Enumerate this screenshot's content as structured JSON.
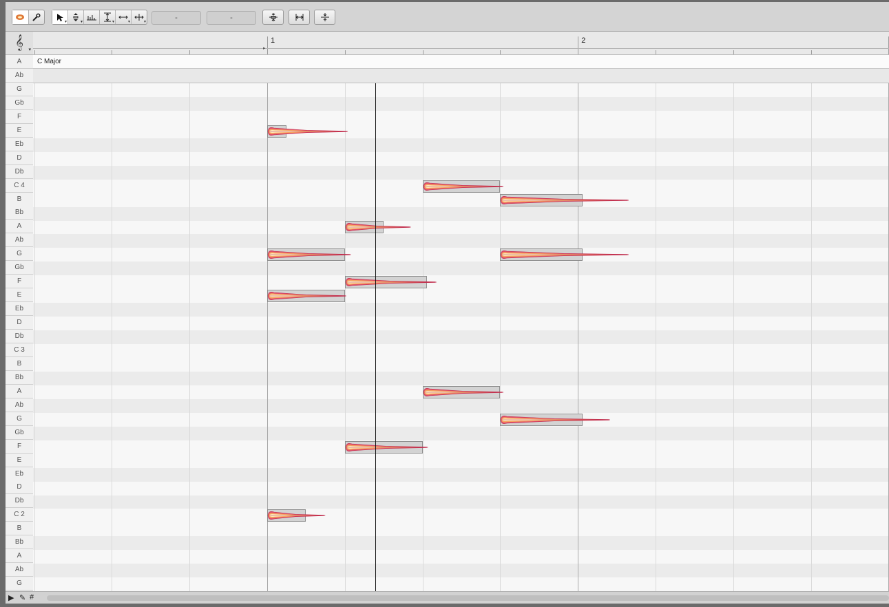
{
  "toolbar": {
    "field1": "-",
    "field2": "-",
    "icons": [
      "melodyne-logo-icon",
      "wrench-icon",
      "pointer-tool-icon",
      "pitch-tool-icon",
      "formant-tool-icon",
      "amplitude-tool-icon",
      "time-tool-icon",
      "separation-tool-icon",
      "pitch-quantize-icon",
      "time-quantize-icon",
      "center-icon"
    ]
  },
  "ruler": {
    "bars": [
      "1",
      "2"
    ]
  },
  "clef_icon": "treble-clef-icon",
  "scale_label": "C Major",
  "key_labels": [
    "A",
    "Ab",
    "G",
    "Gb",
    "F",
    "E",
    "Eb",
    "D",
    "Db",
    "C 4",
    "B",
    "Bb",
    "A",
    "Ab",
    "G",
    "Gb",
    "F",
    "E",
    "Eb",
    "D",
    "Db",
    "C 3",
    "B",
    "Bb",
    "A",
    "Ab",
    "G",
    "Gb",
    "F",
    "E",
    "Eb",
    "D",
    "Db",
    "C 2",
    "B",
    "Bb",
    "A",
    "Ab",
    "G"
  ],
  "notes": [
    {
      "pitch": "E4",
      "lane": 5,
      "start": 0.0,
      "end": 0.25,
      "tail": 1.02
    },
    {
      "pitch": "C4",
      "lane": 9,
      "start": 2.0,
      "end": 3.0,
      "tail": 3.02
    },
    {
      "pitch": "B3",
      "lane": 10,
      "start": 3.0,
      "end": 4.06,
      "tail": 4.64
    },
    {
      "pitch": "A3",
      "lane": 12,
      "start": 1.0,
      "end": 1.5,
      "tail": 1.83
    },
    {
      "pitch": "G3",
      "lane": 14,
      "start": 0.0,
      "end": 1.0,
      "tail": 1.06
    },
    {
      "pitch": "G3",
      "lane": 14,
      "start": 3.0,
      "end": 4.06,
      "tail": 4.64
    },
    {
      "pitch": "F3",
      "lane": 16,
      "start": 1.0,
      "end": 2.06,
      "tail": 2.16
    },
    {
      "pitch": "E3",
      "lane": 17,
      "start": 0.0,
      "end": 1.0,
      "tail": 1.0
    },
    {
      "pitch": "A2",
      "lane": 24,
      "start": 2.0,
      "end": 3.0,
      "tail": 3.02
    },
    {
      "pitch": "G2",
      "lane": 26,
      "start": 3.0,
      "end": 4.06,
      "tail": 4.4
    },
    {
      "pitch": "F2",
      "lane": 28,
      "start": 1.0,
      "end": 2.0,
      "tail": 2.05
    },
    {
      "pitch": "C2",
      "lane": 33,
      "start": 0.0,
      "end": 0.5,
      "tail": 0.73
    }
  ],
  "playhead_beat": 1.39,
  "status_icons": [
    "pointer-status-icon",
    "tool-status-icon",
    "grid-status-icon"
  ]
}
